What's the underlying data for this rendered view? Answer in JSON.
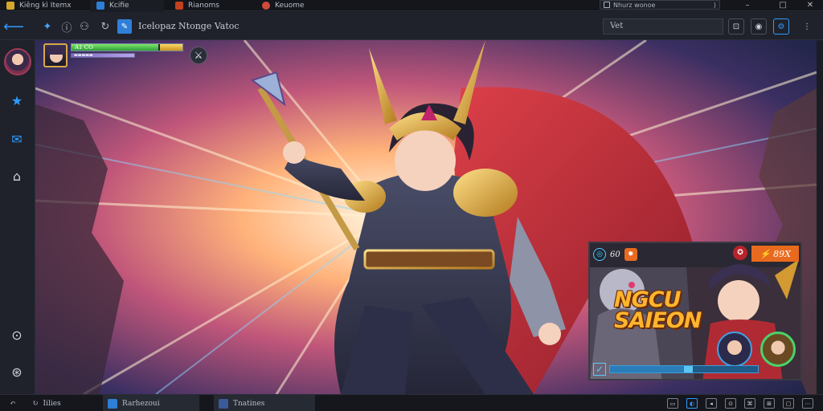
{
  "tabs": [
    {
      "label": "Kiêng kì Itemx",
      "color": "#d4a72c"
    },
    {
      "label": "Kcifie",
      "color": "#2f7fd8"
    },
    {
      "label": "Rianoms",
      "color": "#c2411f"
    },
    {
      "label": "Keuome",
      "color": "#d04a3a"
    }
  ],
  "window": {
    "search_text": "Nhurz wonoe",
    "search_icon": "search-icon",
    "chevron": "⟨⟩"
  },
  "toolbar": {
    "title": "Icelopaz  Ntonge  Vatoc",
    "address": "Vet"
  },
  "hud": {
    "hp_text": "A1 CO",
    "hp_fraction": 0.78,
    "mp_text": "▬▬▬▬▬"
  },
  "panel": {
    "label": "60",
    "badge": "⚡ 89X",
    "title_line1": "NGCU",
    "title_line2": "SAIEON",
    "progress": 0.5
  },
  "bottombar": {
    "items": [
      {
        "label": "Iilies"
      },
      {
        "label": "Rarhezoui"
      },
      {
        "label": "Tnatines"
      }
    ]
  },
  "colors": {
    "accent": "#2f9bff",
    "tab_bg": "#14161c",
    "toolbar_bg": "#1f222a",
    "hp_green": "#2e9e3a",
    "gold": "#e9b43a",
    "badge_orange": "#e86a1e"
  }
}
